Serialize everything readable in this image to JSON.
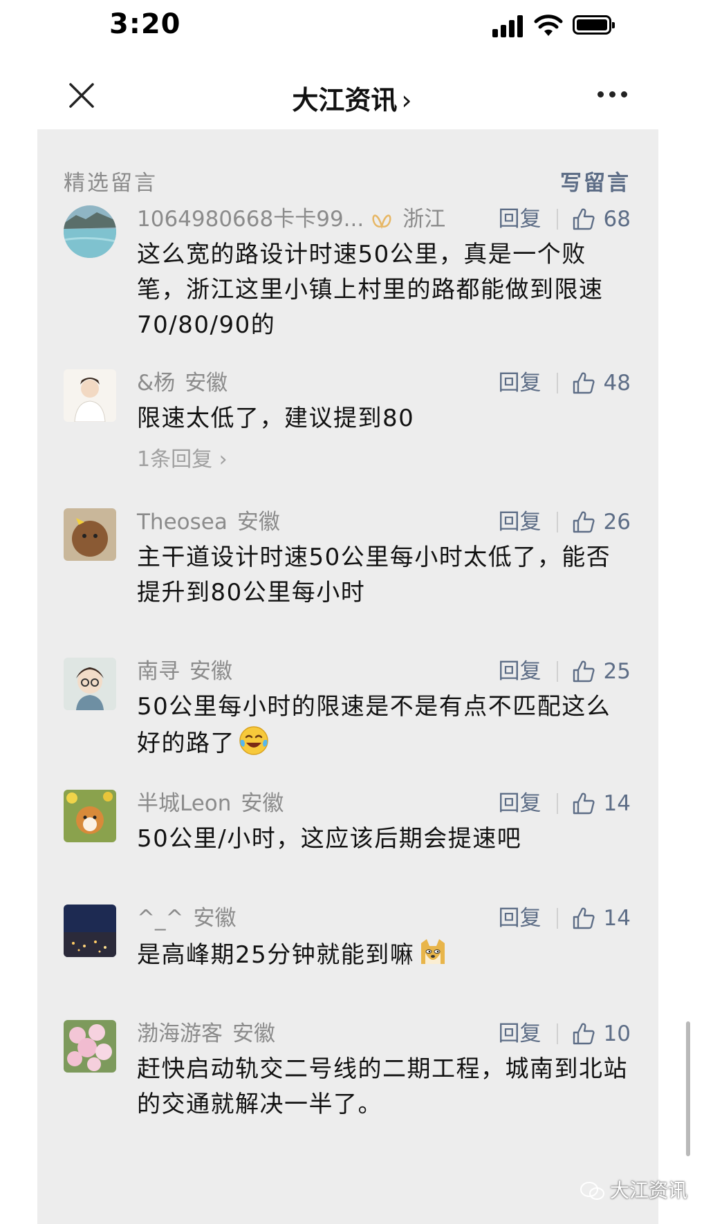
{
  "status_bar": {
    "time": "3:20"
  },
  "nav": {
    "title": "大江资讯",
    "chevron": "›"
  },
  "section": {
    "title": "精选留言",
    "write_label": "写留言"
  },
  "comments": [
    {
      "user": "1064980668卡卡99...",
      "region": "浙江",
      "has_badge": true,
      "reply_label": "回复",
      "likes": "68",
      "text": "这么宽的路设计时速50公里，真是一个败笔，浙江这里小镇上村里的路都能做到限速70/80/90的"
    },
    {
      "user": "&杨",
      "region": "安徽",
      "reply_label": "回复",
      "likes": "48",
      "text": "限速太低了，建议提到80",
      "sub_replies": "1条回复"
    },
    {
      "user": "Theosea",
      "region": "安徽",
      "reply_label": "回复",
      "likes": "26",
      "text": "主干道设计时速50公里每小时太低了，能否提升到80公里每小时"
    },
    {
      "user": "南寻",
      "region": "安徽",
      "reply_label": "回复",
      "likes": "25",
      "text": "50公里每小时的限速是不是有点不匹配这么好的路了",
      "emoji": "laughing-tears-emoji"
    },
    {
      "user": "半城Leon",
      "region": "安徽",
      "reply_label": "回复",
      "likes": "14",
      "text": "50公里/小时，这应该后期会提速吧"
    },
    {
      "user": "^_^",
      "region": "安徽",
      "reply_label": "回复",
      "likes": "14",
      "text": "是高峰期25分钟就能到嘛",
      "emoji": "doge-emoji"
    },
    {
      "user": "渤海游客",
      "region": "安徽",
      "reply_label": "回复",
      "likes": "10",
      "text": "赶快启动轨交二号线的二期工程，城南到北站的交通就解决一半了。"
    }
  ],
  "watermark": "大江资讯",
  "colors": {
    "accent": "#5d6d86",
    "panel_bg": "#ededed",
    "muted": "#8b8b8b"
  }
}
